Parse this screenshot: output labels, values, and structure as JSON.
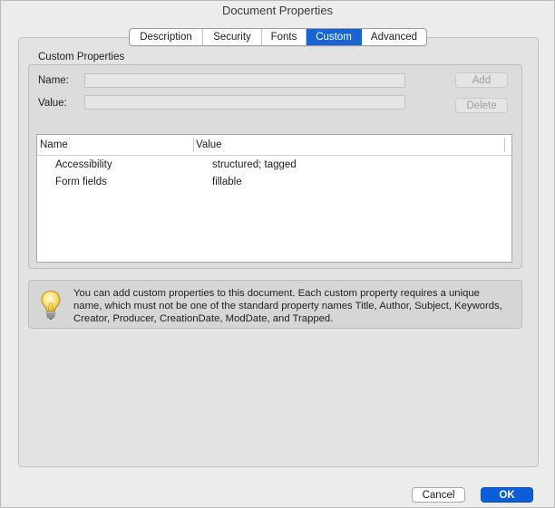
{
  "window": {
    "title": "Document Properties"
  },
  "tabs": [
    {
      "label": "Description",
      "active": false
    },
    {
      "label": "Security",
      "active": false
    },
    {
      "label": "Fonts",
      "active": false
    },
    {
      "label": "Custom",
      "active": true
    },
    {
      "label": "Advanced",
      "active": false
    }
  ],
  "custom": {
    "section_title": "Custom Properties",
    "name_label": "Name:",
    "name_value": "",
    "value_label": "Value:",
    "value_value": "",
    "add_label": "Add",
    "delete_label": "Delete",
    "table": {
      "columns": [
        "Name",
        "Value"
      ],
      "rows": [
        {
          "name": "Accessibility",
          "value": "structured; tagged"
        },
        {
          "name": "Form fields",
          "value": "fillable"
        }
      ]
    },
    "info": {
      "icon": "lightbulb-icon",
      "text": "You can add custom properties to this document. Each custom property requires a unique name, which must not be one of the standard property names Title, Author, Subject, Keywords, Creator, Producer, CreationDate, ModDate, and Trapped."
    }
  },
  "footer": {
    "cancel_label": "Cancel",
    "ok_label": "OK"
  },
  "colors": {
    "accent": "#1a63d3",
    "ok_button": "#0b5ed7",
    "window_bg": "#ececec"
  }
}
